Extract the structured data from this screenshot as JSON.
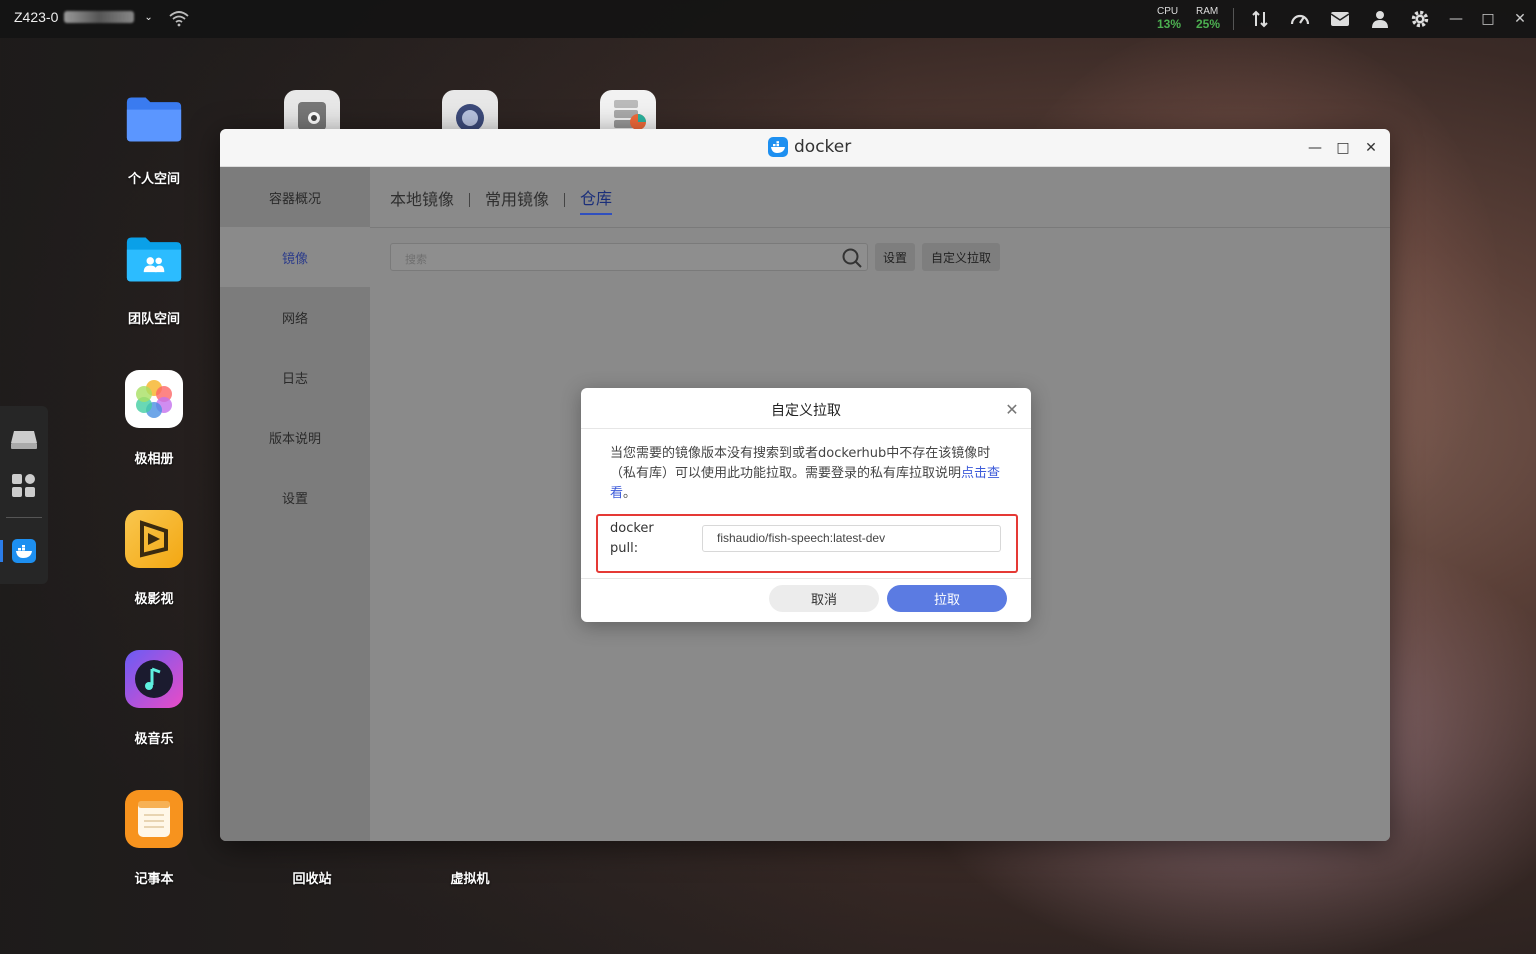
{
  "topbar": {
    "device_name": "Z423-0",
    "cpu_label": "CPU",
    "cpu_value": "13%",
    "ram_label": "RAM",
    "ram_value": "25%"
  },
  "desktop": {
    "icons": [
      {
        "label": "个人空间"
      },
      {
        "label": "团队空间"
      },
      {
        "label": "极相册"
      },
      {
        "label": "极影视"
      },
      {
        "label": "极音乐"
      },
      {
        "label": "记事本"
      },
      {
        "label": "回收站"
      },
      {
        "label": "虚拟机"
      }
    ]
  },
  "window": {
    "title": "docker",
    "sidebar": [
      "容器概况",
      "镜像",
      "网络",
      "日志",
      "版本说明",
      "设置"
    ],
    "tabs": [
      "本地镜像",
      "常用镜像",
      "仓库"
    ],
    "search_placeholder": "搜索",
    "settings_button": "设置",
    "custom_pull_button": "自定义拉取"
  },
  "modal": {
    "title": "自定义拉取",
    "description": "当您需要的镜像版本没有搜索到或者dockerhub中不存在该镜像时（私有库）可以使用此功能拉取。需要登录的私有库拉取说明",
    "link_text": "点击查看",
    "description_end": "。",
    "pull_label": "docker pull:",
    "pull_value": "fishaudio/fish-speech:latest-dev",
    "cancel_label": "取消",
    "pull_button_label": "拉取"
  },
  "colors": {
    "accent": "#5b7be2",
    "active_nav": "#2d3d8a",
    "highlight_box": "#e53935",
    "stat_green": "#4caf50"
  }
}
